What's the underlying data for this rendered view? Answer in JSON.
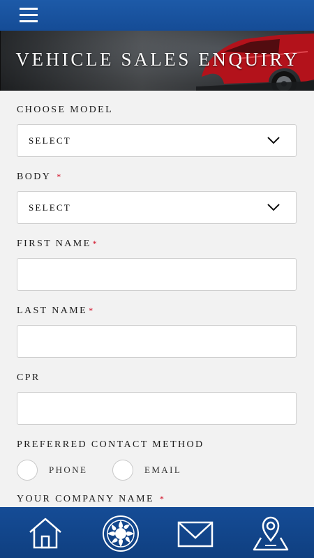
{
  "header": {
    "menu_icon": "hamburger-menu-icon"
  },
  "banner": {
    "title": "VEHICLE SALES ENQUIRY"
  },
  "form": {
    "model": {
      "label": "CHOOSE MODEL",
      "value": "SELECT"
    },
    "body": {
      "label": "BODY",
      "required_mark": "*",
      "value": "SELECT"
    },
    "first_name": {
      "label": "FIRST NAME",
      "required_mark": "*",
      "value": ""
    },
    "last_name": {
      "label": "LAST NAME",
      "required_mark": "*",
      "value": ""
    },
    "cpr": {
      "label": "CPR",
      "value": ""
    },
    "contact_method": {
      "label": "PREFERRED CONTACT METHOD",
      "options": [
        "PHONE",
        "EMAIL"
      ]
    },
    "company_name": {
      "label": "YOUR COMPANY NAME",
      "required_mark": "*"
    }
  },
  "bottom_nav": {
    "items": [
      "home-icon",
      "brand-emblem-icon",
      "mail-icon",
      "map-location-icon"
    ]
  },
  "colors": {
    "bar_blue": "#154c96",
    "required_red": "#d0021b",
    "page_bg": "#f2f2f2"
  }
}
